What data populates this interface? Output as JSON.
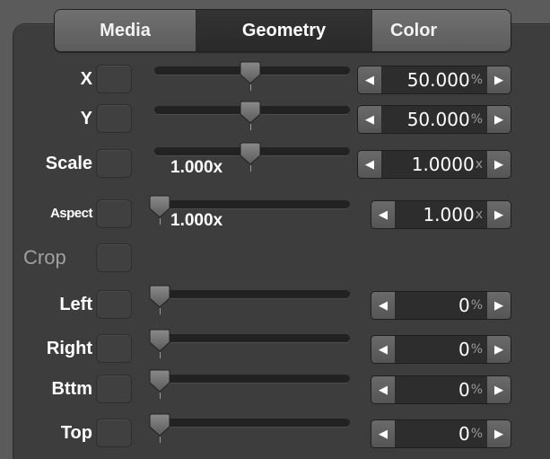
{
  "tabs": [
    {
      "label": "Media",
      "active": false
    },
    {
      "label": "Geometry",
      "active": true
    },
    {
      "label": "Color",
      "active": false
    }
  ],
  "params": [
    {
      "key": "x",
      "label": "X",
      "slider_position": 0.5,
      "slider_value_text": "",
      "stepper_value": "50.000",
      "unit": "%"
    },
    {
      "key": "y",
      "label": "Y",
      "slider_position": 0.5,
      "slider_value_text": "",
      "stepper_value": "50.000",
      "unit": "%"
    },
    {
      "key": "scale",
      "label": "Scale",
      "slider_position": 0.5,
      "slider_value_text": "1.000x",
      "stepper_value": "1.0000",
      "unit": "x"
    },
    {
      "key": "aspect",
      "label": "Aspect",
      "slider_position": 0.0,
      "slider_value_text": "1.000x",
      "stepper_value": "1.000",
      "unit": "x"
    },
    {
      "key": "crop",
      "label": "Crop",
      "section": true
    },
    {
      "key": "left",
      "label": "Left",
      "slider_position": 0.0,
      "slider_value_text": "",
      "stepper_value": "0",
      "unit": "%"
    },
    {
      "key": "right",
      "label": "Right",
      "slider_position": 0.0,
      "slider_value_text": "",
      "stepper_value": "0",
      "unit": "%"
    },
    {
      "key": "bttm",
      "label": "Bttm",
      "slider_position": 0.0,
      "slider_value_text": "",
      "stepper_value": "0",
      "unit": "%"
    },
    {
      "key": "top",
      "label": "Top",
      "slider_position": 0.0,
      "slider_value_text": "",
      "stepper_value": "0",
      "unit": "%"
    }
  ],
  "icons": {
    "decrement": "triangle-left-icon",
    "increment": "triangle-right-icon",
    "slider_knob": "slider-knob-icon"
  },
  "colors": {
    "panel_bg": "#3d3d3d",
    "active_tab": "#2d2d2d",
    "section_label": "#a0a0a0"
  }
}
